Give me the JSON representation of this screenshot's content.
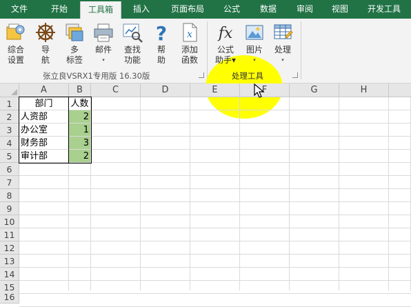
{
  "menu": {
    "tabs": [
      "文件",
      "开始",
      "工具箱",
      "插入",
      "页面布局",
      "公式",
      "数据",
      "审阅",
      "视图",
      "开发工具"
    ],
    "active_tab": "工具箱"
  },
  "ribbon": {
    "group1": {
      "label": "张立良VSRX1专用版 16.30版",
      "buttons": [
        {
          "line1": "综合",
          "line2": "设置"
        },
        {
          "line1": "导",
          "line2": "航"
        },
        {
          "line1": "多",
          "line2": "标签"
        },
        {
          "line1": "邮件",
          "line2": "▾"
        },
        {
          "line1": "查找",
          "line2": "功能"
        },
        {
          "line1": "帮",
          "line2": "助"
        },
        {
          "line1": "添加",
          "line2": "函数"
        }
      ]
    },
    "group2": {
      "label": "处理工具",
      "buttons": [
        {
          "line1": "公式",
          "line2": "助手▾"
        },
        {
          "line1": "图片",
          "line2": "▾"
        },
        {
          "line1": "处理",
          "line2": "▾"
        }
      ]
    }
  },
  "sheet": {
    "columns": [
      "A",
      "B",
      "C",
      "D",
      "E",
      "F",
      "G",
      "H"
    ],
    "rows": [
      "1",
      "2",
      "3",
      "4",
      "5",
      "6",
      "7",
      "8",
      "9",
      "10",
      "11",
      "12",
      "13",
      "14",
      "15",
      "16"
    ],
    "header": {
      "a": "部门",
      "b": "人数"
    },
    "data": [
      {
        "a": "人资部",
        "b": "2"
      },
      {
        "a": "办公室",
        "b": "1"
      },
      {
        "a": "财务部",
        "b": "3"
      },
      {
        "a": "审计部",
        "b": "2"
      }
    ]
  },
  "colors": {
    "brand": "#217346",
    "highlight": "#ffff00",
    "cell_green": "#a9d08e"
  }
}
